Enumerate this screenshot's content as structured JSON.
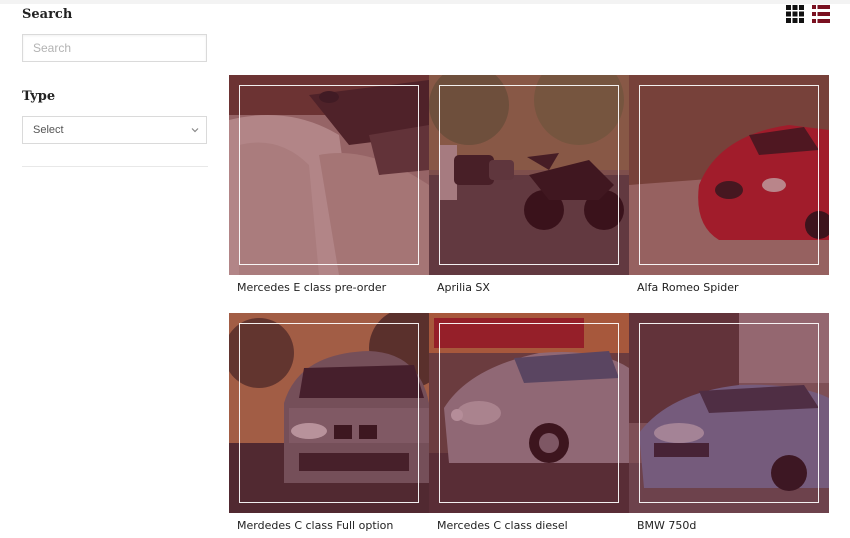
{
  "sidebar": {
    "search": {
      "title": "Search",
      "placeholder": "Search",
      "value": ""
    },
    "type": {
      "title": "Type",
      "selected": "Select"
    }
  },
  "view_toggles": [
    {
      "name": "grid-view",
      "icon": "grid-icon",
      "active": true
    },
    {
      "name": "list-view",
      "icon": "list-icon",
      "active": false
    }
  ],
  "colors": {
    "overlay": "#6e1428",
    "list_icon": "#7a1020",
    "grid_icon": "#111111"
  },
  "listings": [
    {
      "title": "Mercedes E class pre-order",
      "image": "car-interior-image"
    },
    {
      "title": "Aprilia SX",
      "image": "motorcycle-image"
    },
    {
      "title": "Alfa Romeo Spider",
      "image": "red-sports-car-image"
    },
    {
      "title": "Merdedes C class Full option",
      "image": "bmw-front-image"
    },
    {
      "title": "Mercedes C class diesel",
      "image": "silver-mercedes-image"
    },
    {
      "title": "BMW 750d",
      "image": "blue-bmw-image"
    }
  ]
}
